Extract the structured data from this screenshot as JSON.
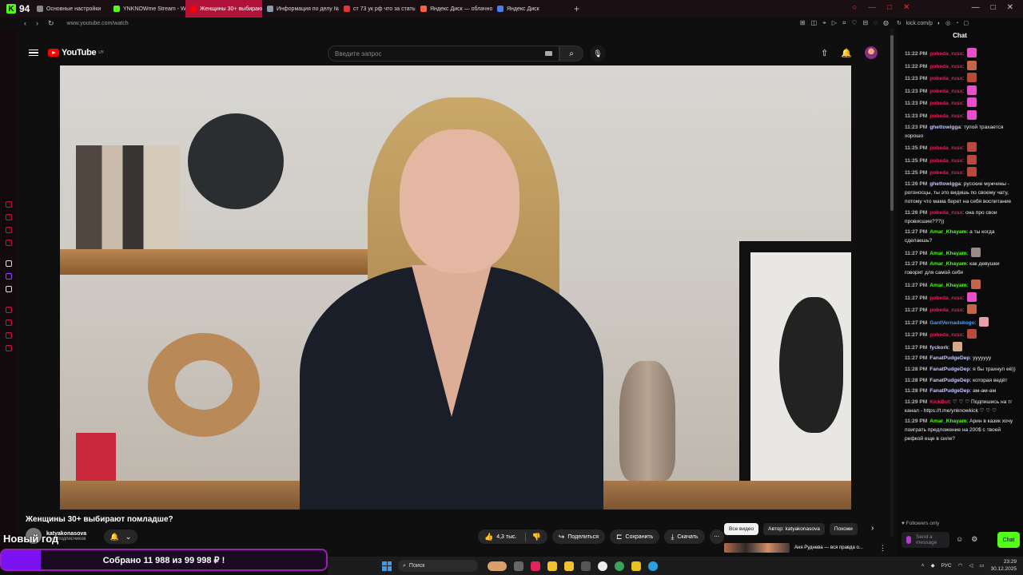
{
  "browser": {
    "tab_counter": "94",
    "tabs": [
      {
        "label": "Основные настройки",
        "color": "#888888"
      },
      {
        "label": "YNKNOWme Stream - Wa",
        "color": "#53fc18"
      },
      {
        "label": "Женщины 30+ выбирают",
        "color": "#ff0000",
        "active": true
      },
      {
        "label": "Информация по делу №",
        "color": "#8a9bb0"
      },
      {
        "label": "ст 73 ук рф что за статья",
        "color": "#e33333"
      },
      {
        "label": "Яндекс Диск — облачное",
        "color": "#ff6040"
      },
      {
        "label": "Яндекс Диск",
        "color": "#4a7ff0"
      }
    ],
    "url": "www.youtube.com/watch",
    "side_url": "kick.com/p"
  },
  "youtube": {
    "logo_text": "YouTube",
    "logo_region": "UY",
    "search_placeholder": "Введите запрос"
  },
  "video": {
    "title": "Женщины 30+ выбирают помладше?",
    "channel": "katyakonasova",
    "subscribers": "...ны подписчиков",
    "likes": "4,3 тыс.",
    "share": "Поделиться",
    "save": "Сохранить",
    "download": "Скачать"
  },
  "recommendations": {
    "chips": [
      "Все видео",
      "Автор: katyakonasova",
      "Похожи"
    ],
    "first_item": "Аня Руднева — вся правда о..."
  },
  "chat": {
    "title": "Chat",
    "messages": [
      {
        "time": "11:22 PM",
        "user": "pobeda_rusx",
        "color": "#e0245e",
        "text": "",
        "emote": "#e84fc8"
      },
      {
        "time": "11:22 PM",
        "user": "pobeda_rusx",
        "color": "#e0245e",
        "text": "",
        "emote": "#c2664a"
      },
      {
        "time": "11:23 PM",
        "user": "pobeda_rusx",
        "color": "#e0245e",
        "text": "",
        "emote": "#b84a3a"
      },
      {
        "time": "11:23 PM",
        "user": "pobeda_rusx",
        "color": "#e0245e",
        "text": "",
        "emote": "#e84fc8"
      },
      {
        "time": "11:23 PM",
        "user": "pobeda_rusx",
        "color": "#e0245e",
        "text": "",
        "emote": "#e84fc8"
      },
      {
        "time": "11:23 PM",
        "user": "pobeda_rusx",
        "color": "#e0245e",
        "text": "",
        "emote": "#e84fc8"
      },
      {
        "time": "11:23 PM",
        "user": "ghettowigga",
        "color": "#c9c9ff",
        "text": "тупой трахается хорошо",
        "emote": ""
      },
      {
        "time": "11:25 PM",
        "user": "pobeda_rusx",
        "color": "#e0245e",
        "text": "",
        "emote": "#b84a3a"
      },
      {
        "time": "11:25 PM",
        "user": "pobeda_rusx",
        "color": "#e0245e",
        "text": "",
        "emote": "#b84a3a"
      },
      {
        "time": "11:25 PM",
        "user": "pobeda_rusx",
        "color": "#e0245e",
        "text": "",
        "emote": "#b84a3a"
      },
      {
        "time": "11:26 PM",
        "user": "ghettowigga",
        "color": "#c9c9ff",
        "text": "русские мужчины - рогоносцы, ты это видишь по своему чату, потому что мама берет на себя воспитание",
        "emote": ""
      },
      {
        "time": "11:26 PM",
        "user": "pobeda_rusx",
        "color": "#e0245e",
        "text": "она про свои провисшие???))",
        "emote": ""
      },
      {
        "time": "11:27 PM",
        "user": "Amar_Khayam",
        "color": "#53fc18",
        "text": "а ты когда сделаешь?",
        "emote": ""
      },
      {
        "time": "11:27 PM",
        "user": "Amar_Khayam",
        "color": "#53fc18",
        "text": "",
        "emote": "#9a8a86"
      },
      {
        "time": "11:27 PM",
        "user": "Amar_Khayam",
        "color": "#53fc18",
        "text": "как девушки говорят для самой себя",
        "emote": ""
      },
      {
        "time": "11:27 PM",
        "user": "Amar_Khayam",
        "color": "#53fc18",
        "text": "",
        "emote": "#c2664a"
      },
      {
        "time": "11:27 PM",
        "user": "pobeda_rusx",
        "color": "#e0245e",
        "text": "",
        "emote": "#e84fc8"
      },
      {
        "time": "11:27 PM",
        "user": "pobeda_rusx",
        "color": "#e0245e",
        "text": "",
        "emote": "#c2664a"
      },
      {
        "time": "11:27 PM",
        "user": "GantVernadskogo",
        "color": "#4aa3ff",
        "text": "",
        "emote": "#e8a0a8"
      },
      {
        "time": "11:27 PM",
        "user": "pobeda_rusx",
        "color": "#e0245e",
        "text": "",
        "emote": "#b84a3a"
      },
      {
        "time": "11:27 PM",
        "user": "fyckork",
        "color": "#c9c9ff",
        "text": "",
        "emote": "#d8a88a"
      },
      {
        "time": "11:27 PM",
        "user": "FanatPudgeDep",
        "color": "#c9c9ff",
        "text": "ууууууу",
        "emote": ""
      },
      {
        "time": "11:28 PM",
        "user": "FanatPudgeDep",
        "color": "#c9c9ff",
        "text": "я бы трахнул её))",
        "emote": ""
      },
      {
        "time": "11:28 PM",
        "user": "FanatPudgeDep",
        "color": "#c9c9ff",
        "text": "которая ведёт",
        "emote": ""
      },
      {
        "time": "11:28 PM",
        "user": "FanatPudgeDep",
        "color": "#c9c9ff",
        "text": "ам-ам-ам",
        "emote": ""
      },
      {
        "time": "11:29 PM",
        "user": "KickBot",
        "color": "#e0245e",
        "text": "♡ ♡ ♡ Подпишись на тг канал - https://t.me/ynknowkick ♡ ♡ ♡",
        "emote": ""
      },
      {
        "time": "11:29 PM",
        "user": "Amar_Khayam",
        "color": "#53fc18",
        "text": "Арин в казик хочу поиграть предложение на 200$ с твоей рефкой еще в силе?",
        "emote": ""
      }
    ],
    "followers_only": "Followers only",
    "input_placeholder": "Send a message",
    "send_label": "Chat"
  },
  "overlay": {
    "new_year": "Новый год",
    "donation_text": "Собрано 11 988  из 99 998 ₽ !",
    "donation_fraction": 0.12
  },
  "taskbar": {
    "search": "Поиск",
    "lang": "РУС",
    "time": "23:29",
    "date": "30.12.2025"
  }
}
